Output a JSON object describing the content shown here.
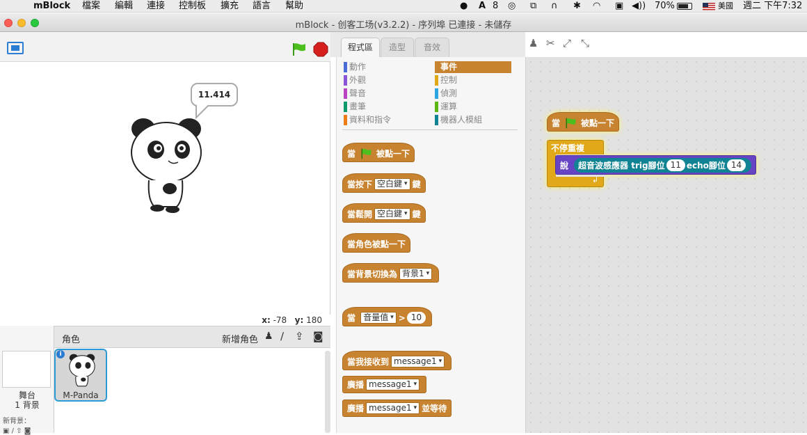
{
  "menubar": {
    "app": "mBlock",
    "items": [
      "檔案",
      "編輯",
      "連接",
      "控制板",
      "擴充",
      "語言",
      "幫助"
    ],
    "status": {
      "adobe_count": "8",
      "battery": "70%",
      "input_method": "美國",
      "clock": "週二 下午7:32"
    }
  },
  "window": {
    "title": "mBlock - 创客工场(v3.2.2) - 序列埠 已連接 - 未儲存"
  },
  "stage": {
    "speech": "11.414",
    "x_label": "x:",
    "x_value": "-78",
    "y_label": "y:",
    "y_value": "180"
  },
  "sprites": {
    "header": "角色",
    "new_sprite": "新增角色",
    "stage_label": "舞台",
    "backdrop_count": "1 背景",
    "new_backdrop": "新背景：",
    "sprite_name": "M-Panda"
  },
  "tabs": [
    "程式區",
    "造型",
    "音效"
  ],
  "categories": {
    "left": [
      "動作",
      "外觀",
      "聲音",
      "畫筆",
      "資料和指令"
    ],
    "right": [
      "事件",
      "控制",
      "偵測",
      "運算",
      "機器人模組"
    ],
    "left_colors": [
      "#4a6cd4",
      "#8a55d7",
      "#bb42c3",
      "#0e9a6c",
      "#ee7d16"
    ],
    "right_colors": [
      "#c88330",
      "#e1a91a",
      "#2ca5e2",
      "#5cb712",
      "#0f8394"
    ],
    "selected": "事件"
  },
  "palette": {
    "when": "當",
    "clicked": "被點一下",
    "key_pressed_pre": "當按下",
    "key_pressed_post": "鍵",
    "key_value": "空白鍵",
    "key_released_pre": "當鬆開",
    "key_released_post": "鍵",
    "sprite_clicked": "當角色被點一下",
    "backdrop_switch": "當背景切換為",
    "backdrop_value": "背景1",
    "sensor_when": "當",
    "sensor_value": "音量值",
    "sensor_op": ">",
    "sensor_num": "10",
    "receive": "當我接收到",
    "message": "message1",
    "broadcast": "廣播",
    "broadcast_wait_post": "並等待"
  },
  "script": {
    "when": "當",
    "clicked": "被點一下",
    "forever": "不停重複",
    "say": "說",
    "sensor": "超音波感應器",
    "trig_label": "trig腳位",
    "trig_pin": "11",
    "echo_label": "echo腳位",
    "echo_pin": "14"
  }
}
